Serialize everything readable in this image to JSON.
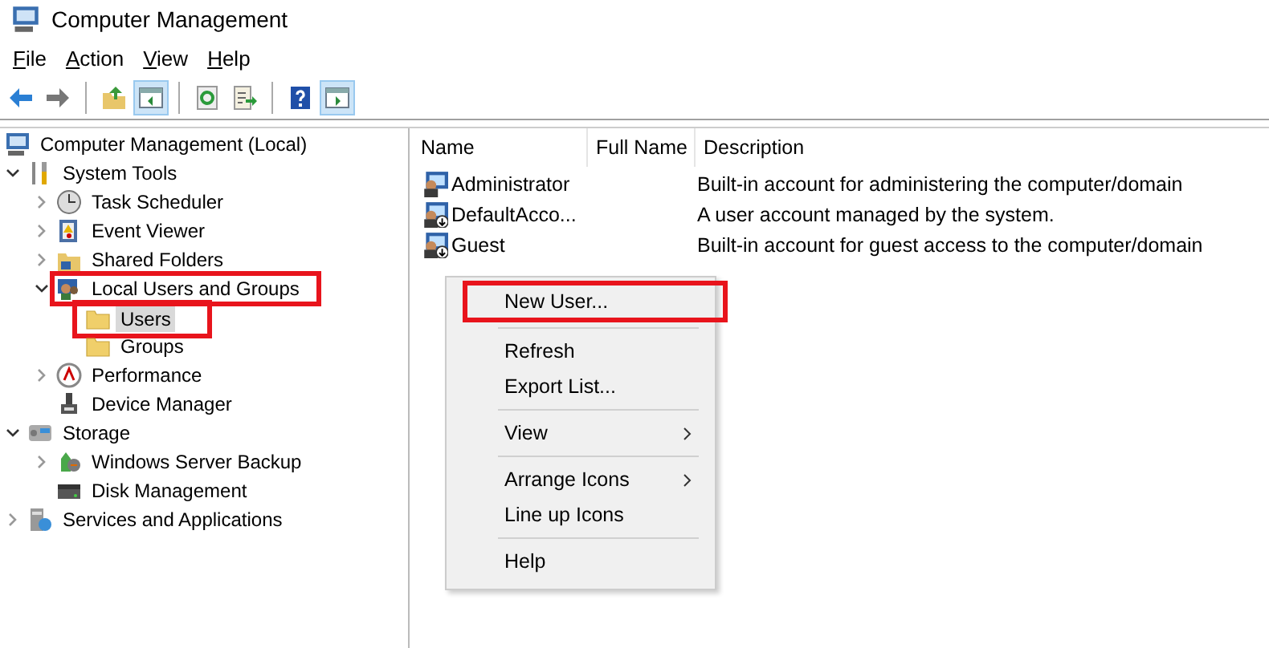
{
  "window": {
    "title": "Computer Management"
  },
  "menu_bar": [
    {
      "label": "File"
    },
    {
      "label": "Action"
    },
    {
      "label": "View"
    },
    {
      "label": "Help"
    }
  ],
  "toolbar": [
    {
      "kind": "back",
      "pressed": false
    },
    {
      "kind": "forward",
      "pressed": false
    },
    {
      "kind": "separator"
    },
    {
      "kind": "up",
      "pressed": false
    },
    {
      "kind": "tree",
      "pressed": true
    },
    {
      "kind": "separator"
    },
    {
      "kind": "refresh",
      "pressed": false
    },
    {
      "kind": "export",
      "pressed": false
    },
    {
      "kind": "separator"
    },
    {
      "kind": "help",
      "pressed": false
    },
    {
      "kind": "action",
      "pressed": true
    }
  ],
  "tree": [
    {
      "label": "Computer Management (Local)",
      "kind": "leaf",
      "selected": false,
      "highlighted": false,
      "children": [
        {
          "label": "System Tools",
          "kind": "node",
          "expanded": true,
          "selected": false,
          "highlighted": false,
          "children": [
            {
              "label": "Task Scheduler",
              "kind": "node",
              "expanded": false,
              "selected": false,
              "highlighted": false
            },
            {
              "label": "Event Viewer",
              "kind": "node",
              "expanded": false,
              "selected": false,
              "highlighted": false
            },
            {
              "label": "Shared Folders",
              "kind": "node",
              "expanded": false,
              "selected": false,
              "highlighted": false
            },
            {
              "label": "Local Users and Groups",
              "kind": "node",
              "expanded": true,
              "selected": false,
              "highlighted": true,
              "children": [
                {
                  "label": "Users",
                  "kind": "leaf",
                  "selected": true,
                  "highlighted": true
                },
                {
                  "label": "Groups",
                  "kind": "leaf",
                  "selected": false,
                  "highlighted": false
                }
              ]
            },
            {
              "label": "Performance",
              "kind": "node",
              "expanded": false,
              "selected": false,
              "highlighted": false
            },
            {
              "label": "Device Manager",
              "kind": "leaf",
              "selected": false,
              "highlighted": false
            }
          ]
        },
        {
          "label": "Storage",
          "kind": "node",
          "expanded": true,
          "selected": false,
          "highlighted": false,
          "children": [
            {
              "label": "Windows Server Backup",
              "kind": "node",
              "expanded": false,
              "selected": false,
              "highlighted": false
            },
            {
              "label": "Disk Management",
              "kind": "leaf",
              "selected": false,
              "highlighted": false
            }
          ]
        },
        {
          "label": "Services and Applications",
          "kind": "node",
          "expanded": false,
          "selected": false,
          "highlighted": false
        }
      ]
    }
  ],
  "list": {
    "columns": [
      "Name",
      "Full Name",
      "Description"
    ],
    "rows": [
      {
        "name": "Administrator",
        "description": "Built-in account for administering the computer/domain",
        "kind": "admin"
      },
      {
        "name": "DefaultAcco...",
        "description": "A user account managed by the system.",
        "kind": "disabled"
      },
      {
        "name": "Guest",
        "description": "Built-in account for guest access to the computer/domain",
        "kind": "disabled"
      }
    ]
  },
  "context_menu": [
    {
      "kind": "item",
      "label": "New User...",
      "submenu": false,
      "highlighted": true
    },
    {
      "kind": "separator"
    },
    {
      "kind": "item",
      "label": "Refresh",
      "submenu": false,
      "highlighted": false
    },
    {
      "kind": "item",
      "label": "Export List...",
      "submenu": false,
      "highlighted": false
    },
    {
      "kind": "separator"
    },
    {
      "kind": "item",
      "label": "View",
      "submenu": true,
      "highlighted": false
    },
    {
      "kind": "separator"
    },
    {
      "kind": "item",
      "label": "Arrange Icons",
      "submenu": true,
      "highlighted": false
    },
    {
      "kind": "item",
      "label": "Line up Icons",
      "submenu": false,
      "highlighted": false
    },
    {
      "kind": "separator"
    },
    {
      "kind": "item",
      "label": "Help",
      "submenu": false,
      "highlighted": false
    }
  ]
}
